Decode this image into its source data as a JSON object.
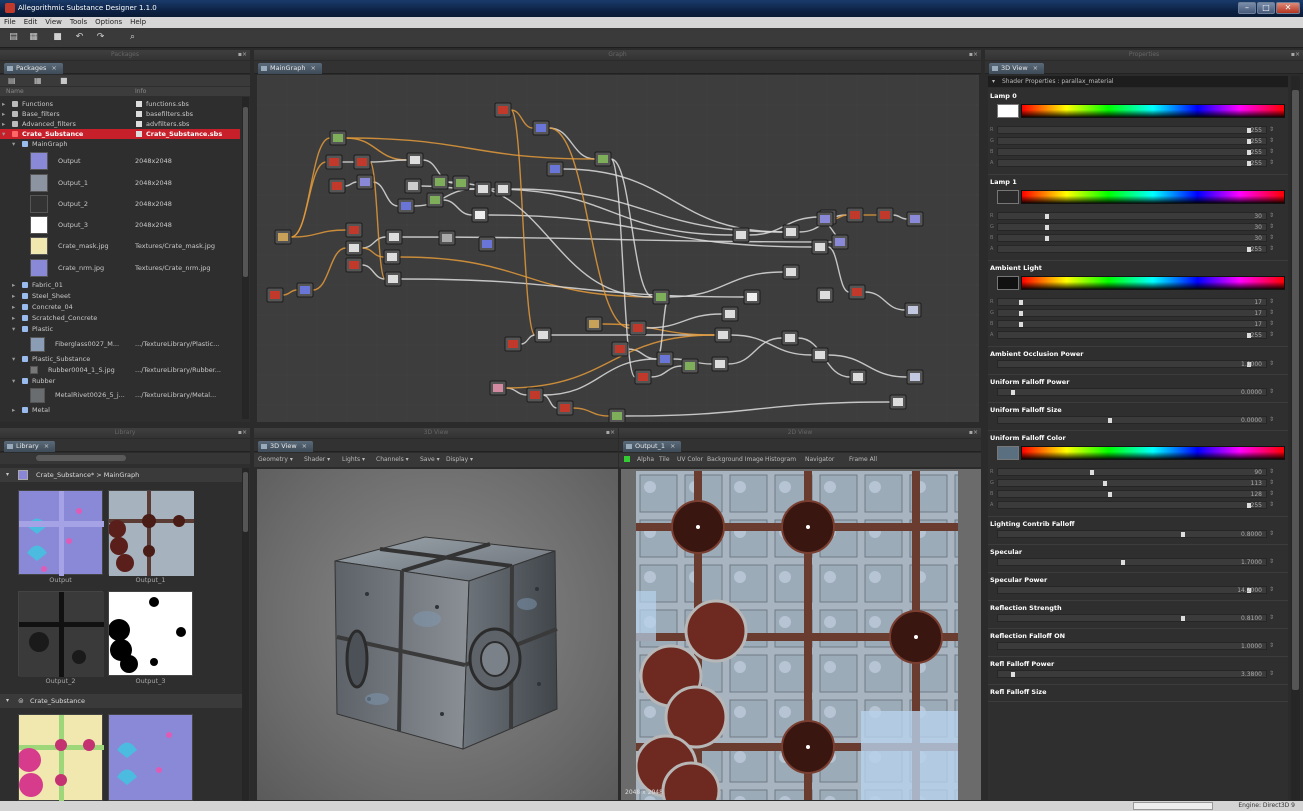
{
  "window": {
    "title": "Allegorithmic Substance Designer 1.1.0"
  },
  "menu": [
    "File",
    "Edit",
    "View",
    "Tools",
    "Options",
    "Help"
  ],
  "toolbar": {
    "icons": [
      "new-icon",
      "open-icon",
      "save-icon",
      "undo-icon",
      "redo-icon",
      "search-icon"
    ]
  },
  "docks": {
    "packages": "Packages",
    "graph": "Graph",
    "properties": "Properties",
    "library": "Library",
    "view3d": "3D View",
    "view2d": "2D View"
  },
  "packages": {
    "tab": "Packages",
    "columns": [
      "Name",
      "Info"
    ],
    "rows": [
      {
        "name": "Functions",
        "info": "functions.sbs"
      },
      {
        "name": "Base_filters",
        "info": "basefilters.sbs"
      },
      {
        "name": "Advanced_filters",
        "info": "advfilters.sbs"
      },
      {
        "name": "Crate_Substance",
        "info": "Crate_Substance.sbs"
      },
      {
        "name": "MainGraph",
        "info": ""
      },
      {
        "name": "Output",
        "info": "2048x2048"
      },
      {
        "name": "Output_1",
        "info": "2048x2048"
      },
      {
        "name": "Output_2",
        "info": "2048x2048"
      },
      {
        "name": "Output_3",
        "info": "2048x2048"
      },
      {
        "name": "Crate_mask.jpg",
        "info": "Textures/Crate_mask.jpg"
      },
      {
        "name": "Crate_nrm.jpg",
        "info": "Textures/Crate_nrm.jpg"
      },
      {
        "name": "Fabric_01",
        "info": ""
      },
      {
        "name": "Steel_Sheet",
        "info": ""
      },
      {
        "name": "Concrete_04",
        "info": ""
      },
      {
        "name": "Scratched_Concrete",
        "info": ""
      },
      {
        "name": "Plastic",
        "info": ""
      },
      {
        "name": "Fiberglass0027_M...",
        "info": ".../TextureLibrary/Plastic..."
      },
      {
        "name": "Plastic_Substance",
        "info": ""
      },
      {
        "name": "Rubber0004_1_S.jpg",
        "info": ".../TextureLibrary/Rubber..."
      },
      {
        "name": "Rubber",
        "info": ""
      },
      {
        "name": "MetalRivet0026_5_j...",
        "info": ".../TextureLibrary/Metal..."
      },
      {
        "name": "Metal",
        "info": ""
      }
    ]
  },
  "graph": {
    "tab": "MainGraph"
  },
  "library": {
    "tab": "Library",
    "group1": {
      "title": "Crate_Substance* > MainGraph",
      "items": [
        "Output",
        "Output_1",
        "Output_2",
        "Output_3"
      ]
    },
    "group2": {
      "title": "Crate_Substance"
    }
  },
  "view3d": {
    "tab": "3D View",
    "menu": [
      "Geometry",
      "Shader",
      "Lights",
      "Channels",
      "Save",
      "Display"
    ]
  },
  "view2d": {
    "tab": "Output_1",
    "menu": [
      "Alpha",
      "Tile",
      "UV Color",
      "Background Image",
      "Histogram",
      "Navigator",
      "Frame All"
    ],
    "footer": "2048 x 2048"
  },
  "properties": {
    "tab": "3D View",
    "header": "Shader Properties : parallax_material",
    "lamp0": {
      "title": "Lamp 0",
      "color": "#ffffff",
      "rows": [
        {
          "l": "R",
          "v": "255",
          "p": 0.95
        },
        {
          "l": "G",
          "v": "255",
          "p": 0.95
        },
        {
          "l": "B",
          "v": "255",
          "p": 0.95
        },
        {
          "l": "A",
          "v": "255",
          "p": 0.95
        }
      ]
    },
    "lamp1": {
      "title": "Lamp 1",
      "color": "#2a2a2a",
      "rows": [
        {
          "l": "R",
          "v": "30",
          "p": 0.18
        },
        {
          "l": "G",
          "v": "30",
          "p": 0.18
        },
        {
          "l": "B",
          "v": "30",
          "p": 0.18
        },
        {
          "l": "A",
          "v": "255",
          "p": 0.95
        }
      ]
    },
    "ambient": {
      "title": "Ambient Light",
      "color": "#111111",
      "rows": [
        {
          "l": "R",
          "v": "17",
          "p": 0.08
        },
        {
          "l": "G",
          "v": "17",
          "p": 0.08
        },
        {
          "l": "B",
          "v": "17",
          "p": 0.08
        },
        {
          "l": "A",
          "v": "255",
          "p": 0.95
        }
      ]
    },
    "aop": {
      "title": "Ambient Occlusion Power",
      "v": "1.0000",
      "p": 0.95
    },
    "ufp": {
      "title": "Uniform Falloff Power",
      "v": "0.0000",
      "p": 0.05
    },
    "ufs": {
      "title": "Uniform Falloff Size",
      "v": "0.0000",
      "p": 0.42
    },
    "ufc": {
      "title": "Uniform Falloff Color",
      "color": "#5a7080",
      "rows": [
        {
          "l": "R",
          "v": "90",
          "p": 0.35
        },
        {
          "l": "G",
          "v": "113",
          "p": 0.4
        },
        {
          "l": "B",
          "v": "128",
          "p": 0.42
        },
        {
          "l": "A",
          "v": "255",
          "p": 0.95
        }
      ]
    },
    "lcf": {
      "title": "Lighting Contrib Falloff",
      "v": "0.8000",
      "p": 0.7
    },
    "spec": {
      "title": "Specular",
      "v": "1.7000",
      "p": 0.47
    },
    "specp": {
      "title": "Specular Power",
      "v": "14.2000",
      "p": 0.95
    },
    "refl": {
      "title": "Reflection Strength",
      "v": "0.8100",
      "p": 0.7
    },
    "reflon": {
      "title": "Reflection Falloff ON",
      "v": "1.0000"
    },
    "rfp": {
      "title": "Refl Falloff Power",
      "v": "3.3800",
      "p": 0.05
    },
    "rfs": {
      "title": "Refl Falloff Size"
    }
  },
  "statusbar": {
    "right": "Engine: Direct3D 9"
  }
}
